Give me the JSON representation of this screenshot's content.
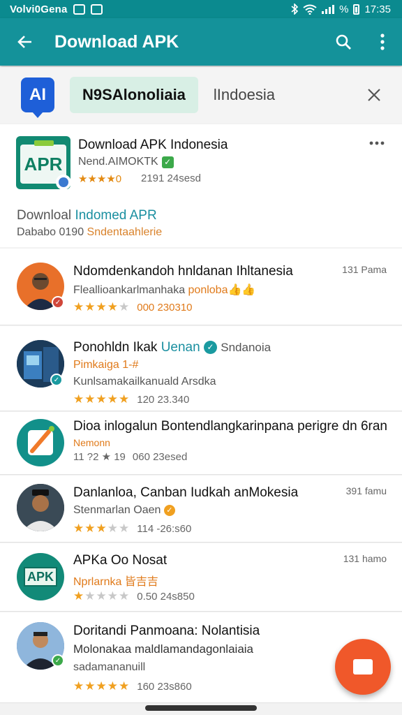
{
  "status_bar": {
    "carrier": "Volvi0Gena",
    "right_text": "%",
    "time": "17:35"
  },
  "app_bar": {
    "title": "Download APK"
  },
  "search": {
    "logo_text": "AI",
    "chip_label": "N9SAlonoliaia",
    "query": "lIndoesia"
  },
  "featured": {
    "icon_text": "APR",
    "title": "Download APK Indonesia",
    "publisher": "Nend.AIMOKTK",
    "rating_text": "★★★★0",
    "count": "2191 24sesd",
    "desc_prefix": "Downloal ",
    "desc_highlight": "Indomed APR",
    "detail_prefix": "Dababo 0190 ",
    "detail_highlight": "Sndentaahlerie"
  },
  "items": [
    {
      "title": "Ndomdenkandoh hnldanan Ihltanesia",
      "sub_prefix": "Fleallioankarlmanhaka ",
      "sub_highlight": "ponloba",
      "sub_emoji": "👍👍",
      "stars_on": 4,
      "stars_total": 5,
      "meta": "000 230310",
      "side": "131 Pama",
      "avatar_bg": "#e8702a",
      "badge_color": "#d0463a"
    },
    {
      "title_prefix": "Ponohldn Ikak ",
      "title_highlight": "Uenan",
      "title_suffix": "Sndanoia",
      "sub_line1": "Pimkaiga 1-#",
      "sub_line2": "Kunlsamakailkanuald Arsdka",
      "stars_on": 5,
      "stars_total": 5,
      "meta": "120  23.340",
      "avatar_bg": "#1b3b5a",
      "badge_color": "#1a9aa0"
    },
    {
      "title": "Dioa inlogalun Bontendlangkarinpana perigre dn 6ran",
      "sub": "Nemonn",
      "meta_prefix": "11 ?2 ★ 19",
      "meta": "060  23esed",
      "avatar_bg": "#12908a"
    },
    {
      "title": "Danlanloa, Canban Iudkah anMokesia",
      "sub": "Stenmarlan Oaen",
      "stars_on": 3,
      "stars_total": 5,
      "meta": "114 -26:s60",
      "side": "391 famu",
      "avatar_bg": "#2b3a46"
    },
    {
      "title": "APKa Oo Nosat",
      "sub": "Nprlarnka 皆吉吉",
      "stars_on": 1,
      "stars_total": 5,
      "meta": "0.50  24s850",
      "side": "131 hamo",
      "icon_text": "APK",
      "avatar_bg": "#128a78"
    },
    {
      "title": "Doritandi Panmoana: Nolantisia",
      "sub_line1": "Molonakaa maldlamandagonlaiaia",
      "sub_line2": "sadamananuill",
      "stars_on": 5,
      "stars_total": 5,
      "meta": "160 23s860",
      "avatar_bg": "#4a7db0",
      "badge_color": "#3ca94a"
    }
  ],
  "colors": {
    "status_bar": "#0b8a8f",
    "app_bar": "#14929a",
    "fab": "#f0582a",
    "star": "#f0a020",
    "accent_orange": "#e07a1a",
    "accent_teal": "#1a8fa0"
  },
  "icons": [
    "back-arrow-icon",
    "search-icon",
    "more-vert-icon",
    "close-icon",
    "more-horiz-icon",
    "verified-icon",
    "chat-icon"
  ]
}
